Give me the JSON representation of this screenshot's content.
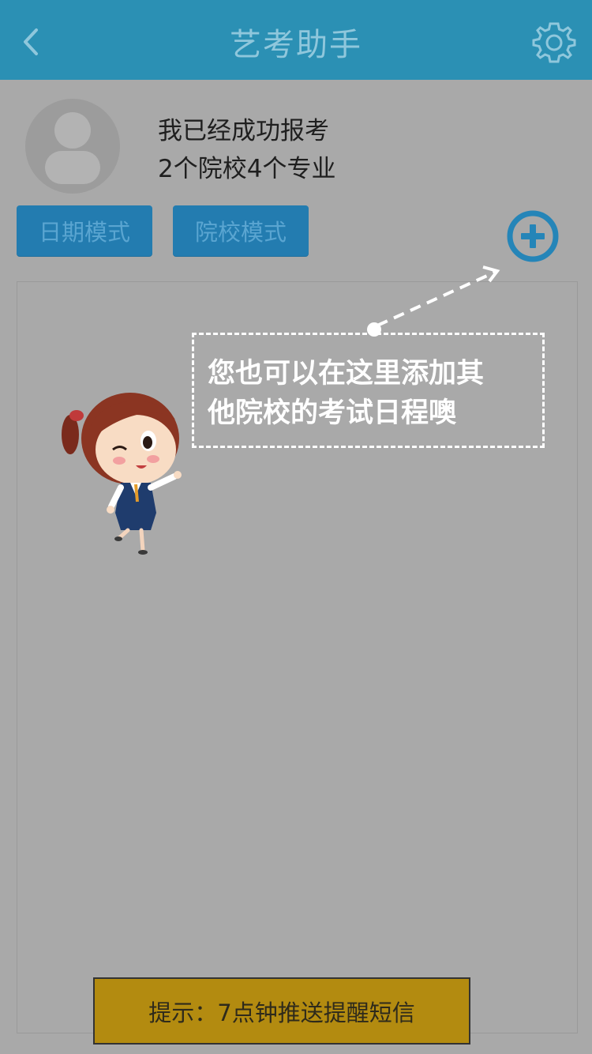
{
  "header": {
    "title": "艺考助手",
    "back_icon": "chevron-left-icon",
    "settings_icon": "gear-icon"
  },
  "profile": {
    "line1": "我已经成功报考",
    "line2": "2个院校4个专业"
  },
  "modes": {
    "date_mode": "日期模式",
    "school_mode": "院校模式"
  },
  "add_icon": "plus-circle-icon",
  "tip": {
    "line1": "您也可以在这里添加其",
    "line2": "他院校的考试日程噢"
  },
  "notice": "提示：7点钟推送提醒短信",
  "colors": {
    "header_bg": "#2b90b4",
    "overlay_bg": "#a9a9a9",
    "button_bg": "#237cb0",
    "notice_bg": "#b38b10"
  }
}
